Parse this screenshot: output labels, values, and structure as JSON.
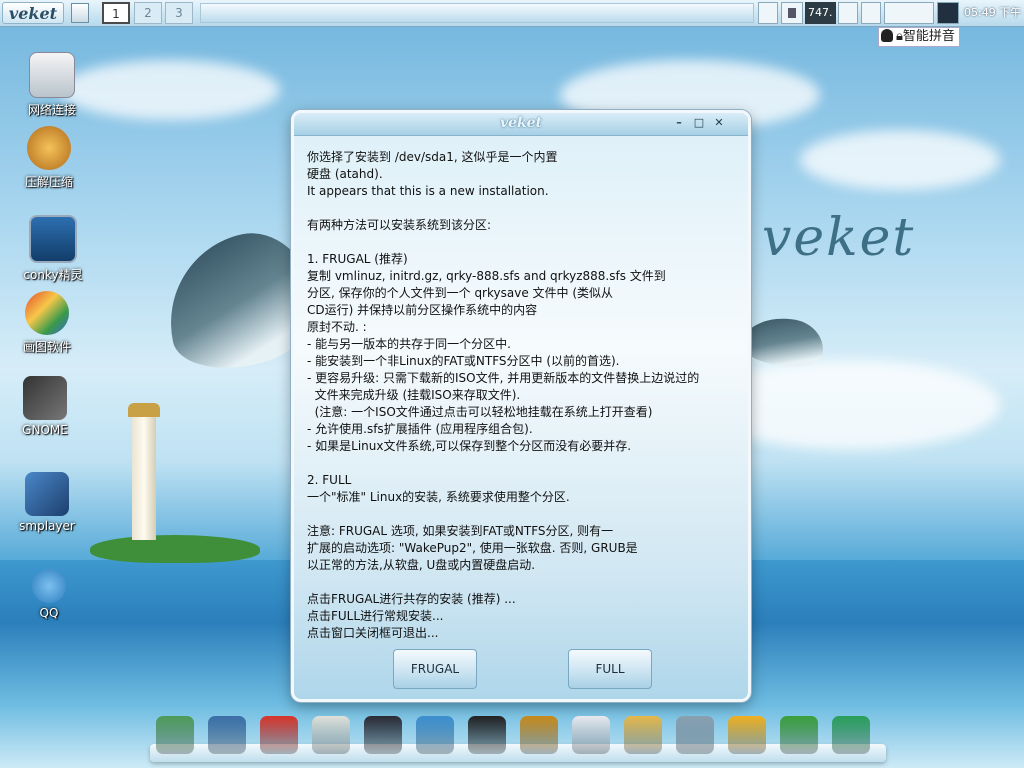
{
  "taskbar": {
    "start_label": "veket",
    "workspaces": [
      "1",
      "2",
      "3"
    ],
    "active_workspace": "1",
    "tray_counter": "747.",
    "time": "05:49",
    "period": "下午"
  },
  "ime": {
    "label": "智能拼音"
  },
  "desktop_icons": [
    {
      "label": "网络连接",
      "icon": "network-icon"
    },
    {
      "label": "压解压缩",
      "icon": "archive-icon"
    },
    {
      "label": "conky精灵",
      "icon": "conky-icon"
    },
    {
      "label": "画图软件",
      "icon": "paint-icon"
    },
    {
      "label": "GNOME",
      "icon": "gnome-icon"
    },
    {
      "label": "smplayer",
      "icon": "smplayer-icon"
    },
    {
      "label": "QQ",
      "icon": "qq-icon"
    }
  ],
  "wallpaper": {
    "logo": "veket"
  },
  "dialog": {
    "title": "veket",
    "lines": [
      "你选择了安装到 /dev/sda1, 这似乎是一个内置",
      "硬盘 (atahd).",
      "It appears that this is a new installation.",
      "",
      "有两种方法可以安装系统到该分区:",
      "",
      "1. FRUGAL (推荐)",
      "复制 vmlinuz, initrd.gz, qrky-888.sfs and qrkyz888.sfs 文件到",
      "分区, 保存你的个人文件到一个 qrkysave 文件中 (类似从",
      "CD运行) 并保持以前分区操作系统中的内容",
      "原封不动. :",
      "- 能与另一版本的共存于同一个分区中.",
      "- 能安装到一个非Linux的FAT或NTFS分区中 (以前的首选).",
      "- 更容易升级: 只需下载新的ISO文件, 并用更新版本的文件替换上边说过的",
      "  文件来完成升级 (挂载ISO来存取文件).",
      "  (注意: 一个ISO文件通过点击可以轻松地挂载在系统上打开查看)",
      "- 允许使用.sfs扩展插件 (应用程序组合包).",
      "- 如果是Linux文件系统,可以保存到整个分区而没有必要并存.",
      "",
      "2. FULL",
      "一个\"标准\" Linux的安装, 系统要求使用整个分区.",
      "",
      "注意: FRUGAL 选项, 如果安装到FAT或NTFS分区, 则有一",
      "扩展的启动选项: \"WakePup2\", 使用一张软盘. 否则, GRUB是",
      "以正常的方法,从软盘, U盘或内置硬盘启动.",
      "",
      "点击FRUGAL进行共存的安装 (推荐) ...",
      "点击FULL进行常规安装...",
      "点击窗口关闭框可退出..."
    ],
    "frugal_button": "FRUGAL",
    "full_button": "FULL"
  },
  "dock": [
    "file-manager-icon",
    "terminal-icon",
    "hedgehog-icon",
    "text-editor-icon",
    "media-player-icon",
    "messenger-icon",
    "penguin-icon",
    "book-icon",
    "presentation-icon",
    "paint-palette-icon",
    "usb-drive-icon",
    "game-icon",
    "help-icon",
    "camera-icon"
  ]
}
